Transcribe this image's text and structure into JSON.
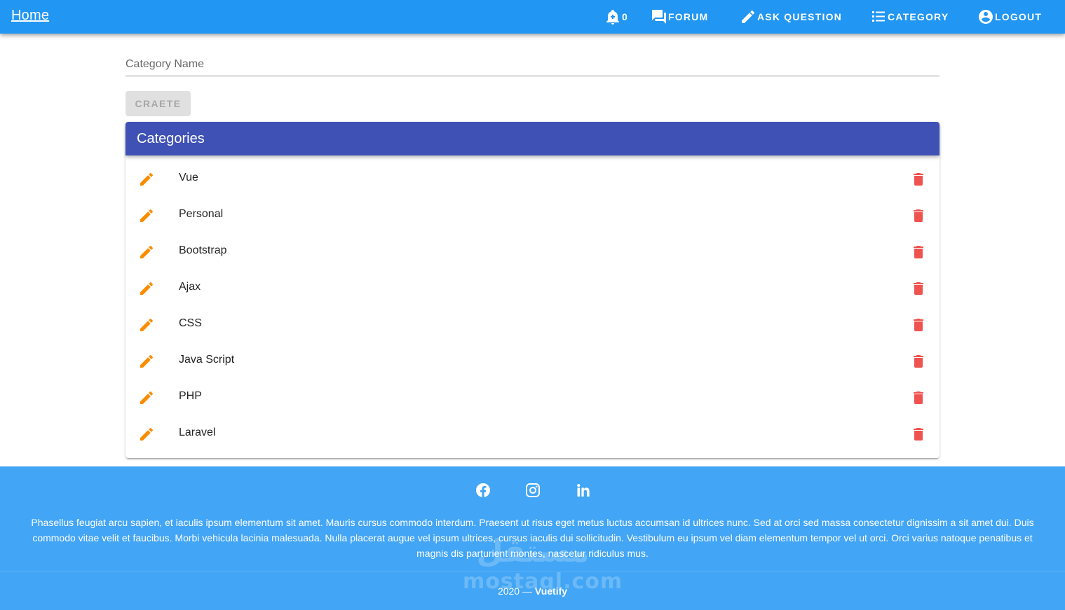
{
  "appbar": {
    "home_label": "Home",
    "notification_count": "0",
    "forum_label": "FORUM",
    "ask_label": "ASK QUESTION",
    "category_label": "CATEGORY",
    "logout_label": "LOGOUT"
  },
  "form": {
    "category_placeholder": "Category Name",
    "category_value": "",
    "create_label": "CRAETE"
  },
  "card": {
    "title": "Categories",
    "items": [
      {
        "label": "Vue"
      },
      {
        "label": "Personal"
      },
      {
        "label": "Bootstrap"
      },
      {
        "label": "Ajax"
      },
      {
        "label": "CSS"
      },
      {
        "label": "Java Script"
      },
      {
        "label": "PHP"
      },
      {
        "label": "Laravel"
      }
    ]
  },
  "footer": {
    "social": [
      "facebook-icon",
      "instagram-icon",
      "linkedin-icon"
    ],
    "text": "Phasellus feugiat arcu sapien, et iaculis ipsum elementum sit amet. Mauris cursus commodo interdum. Praesent ut risus eget metus luctus accumsan id ultrices nunc. Sed at orci sed massa consectetur dignissim a sit amet dui. Duis commodo vitae velit et faucibus. Morbi vehicula lacinia malesuada. Nulla placerat augue vel ipsum ultrices, cursus iaculis dui sollicitudin. Vestibulum eu ipsum vel diam elementum tempor vel ut orci. Orci varius natoque penatibus et magnis dis parturient montes, nascetur ridiculus mus.",
    "year": "2020 —",
    "brand": "Vuetify"
  },
  "watermark": {
    "arabic": "مستقل",
    "latin": "mostaql.com"
  },
  "colors": {
    "appbar": "#2196f3",
    "card_header": "#3f51b5",
    "edit": "#fb8c00",
    "delete": "#ef5350",
    "footer": "#42a5f5"
  }
}
